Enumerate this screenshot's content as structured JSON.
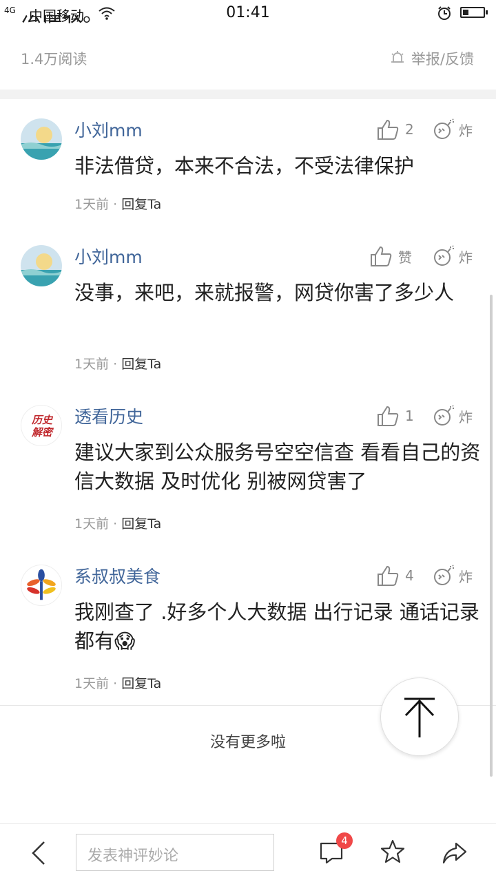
{
  "status": {
    "network": "4G",
    "carrier": "中国移动",
    "time": "01:41"
  },
  "article": {
    "tail_text": "法催收。",
    "read_count": "1.4万阅读",
    "report_label": "举报/反馈"
  },
  "comments": [
    {
      "user": "小刘mm",
      "like": "2",
      "bomb": "炸",
      "text": "非法借贷，本来不合法，不受法律保护",
      "time": "1天前",
      "sep": " · ",
      "reply": "回复Ta"
    },
    {
      "user": "小刘mm",
      "like": "赞",
      "bomb": "炸",
      "text": "没事，来吧，来就报警，网贷你害了多少人",
      "time": "1天前",
      "sep": " · ",
      "reply": "回复Ta"
    },
    {
      "user": "透看历史",
      "like": "1",
      "bomb": "炸",
      "text": "建议大家到公众服务号空空信查 看看自己的资信大数据 及时优化 别被网贷害了",
      "time": "1天前",
      "sep": " · ",
      "reply": "回复Ta",
      "avatar_text": "历史\n解密"
    },
    {
      "user": "系叔叔美食",
      "like": "4",
      "bomb": "炸",
      "text": "我刚查了 .好多个人大数据  出行记录 通话记录都有😱",
      "time": "1天前",
      "sep": " · ",
      "reply": "回复Ta"
    }
  ],
  "list_end": "没有更多啦",
  "bottom_bar": {
    "input_placeholder": "发表神评妙论",
    "comment_count": "4"
  },
  "colors": {
    "username": "#406599",
    "badge": "#f04848",
    "muted": "#999999"
  }
}
